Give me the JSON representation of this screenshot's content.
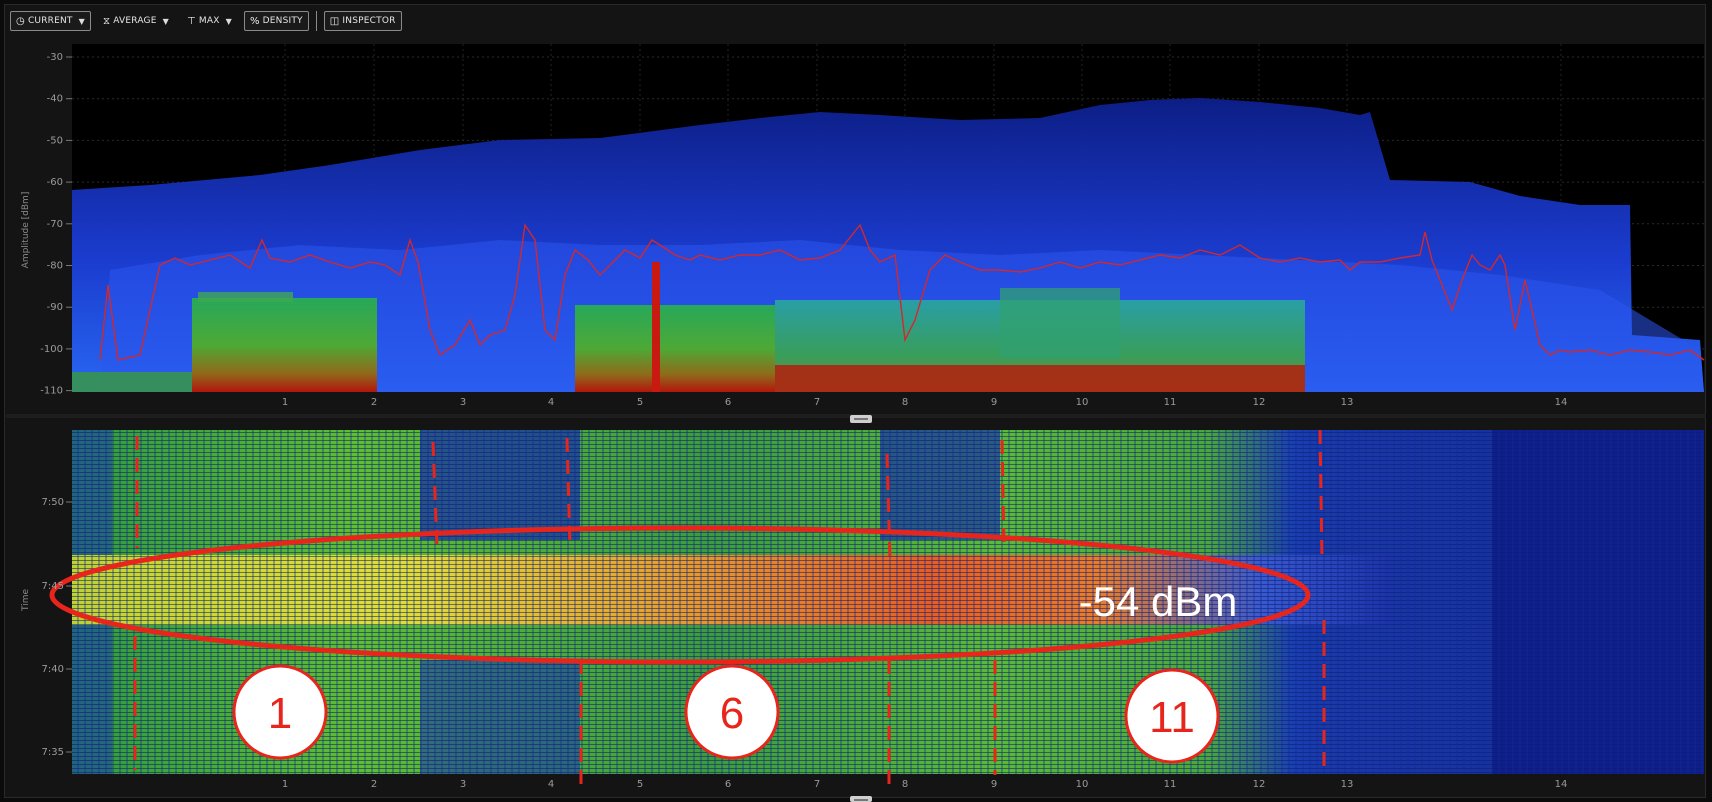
{
  "toolbar": {
    "current_label": "CURRENT",
    "average_label": "AVERAGE",
    "max_label": "MAX",
    "density_label": "DENSITY",
    "inspector_label": "INSPECTOR"
  },
  "spectrum": {
    "y_axis_label": "Amplitude [dBm]",
    "y_ticks": [
      "-30",
      "-40",
      "-50",
      "-60",
      "-70",
      "-80",
      "-90",
      "-100",
      "-110"
    ],
    "x_ticks": [
      "1",
      "2",
      "3",
      "4",
      "5",
      "6",
      "7",
      "8",
      "9",
      "10",
      "11",
      "12",
      "13",
      "14"
    ]
  },
  "waterfall": {
    "y_axis_label": "Time",
    "y_ticks": [
      "7:50",
      "7:45",
      "7:40",
      "7:35"
    ],
    "x_ticks": [
      "1",
      "2",
      "3",
      "4",
      "5",
      "6",
      "7",
      "8",
      "9",
      "10",
      "11",
      "12",
      "13",
      "14"
    ],
    "annotation_text": "-54 dBm",
    "channel_labels": [
      "1",
      "6",
      "11"
    ]
  },
  "colors": {
    "annotation_red": "#e8251c",
    "trace_red": "#d2282f",
    "background": "#0b0b0b"
  }
}
